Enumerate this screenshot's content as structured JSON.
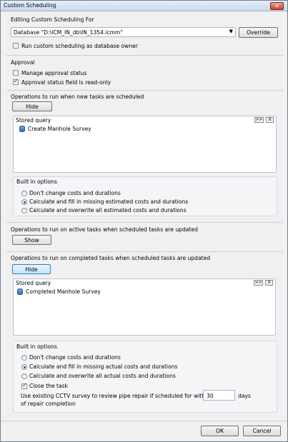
{
  "window": {
    "title": "Custom Scheduling"
  },
  "header": {
    "editing_label": "Editing Custom Scheduling For",
    "database_value": "Database \"D:\\ICM_IN_db\\IN_1354.icmm\"",
    "override_label": "Override",
    "run_as_owner_label": "Run custom scheduling as database owner"
  },
  "approval": {
    "heading": "Approval",
    "manage_label": "Manage approval status",
    "readonly_label": "Approval status field is read-only"
  },
  "new_tasks": {
    "heading": "Operations to run when new tasks are scheduled",
    "toggle_label": "Hide",
    "stored_query_label": "Stored query",
    "query_items": [
      "Create Manhole Survey"
    ],
    "add_btn": ">>",
    "remove_btn": "X",
    "builtin_heading": "Built in options",
    "options": [
      "Don't change costs and durations",
      "Calculate and fill in missing estimated costs and durations",
      "Calculate and overwrite all estimated costs and durations"
    ]
  },
  "active_tasks": {
    "heading": "Operations to run on active tasks when scheduled tasks are updated",
    "toggle_label": "Show"
  },
  "completed_tasks": {
    "heading": "Operations to run on completed tasks when scheduled tasks are updated",
    "toggle_label": "Hide",
    "stored_query_label": "Stored query",
    "query_items": [
      "Completed Manhole Survey"
    ],
    "add_btn": ">>",
    "remove_btn": "X",
    "builtin_heading": "Built in options",
    "options": [
      "Don't change costs and durations",
      "Calculate and fill in missing actual costs and durations",
      "Calculate and overwrite all actual costs and durations"
    ],
    "close_task_label": "Close the task",
    "cctv_label_line1": "Use existing CCTV survey to review pipe repair if scheduled for within",
    "cctv_label_line2": "of repair completion",
    "cctv_days_value": "30",
    "days_label": "days"
  },
  "footer": {
    "ok_label": "OK",
    "cancel_label": "Cancel"
  }
}
